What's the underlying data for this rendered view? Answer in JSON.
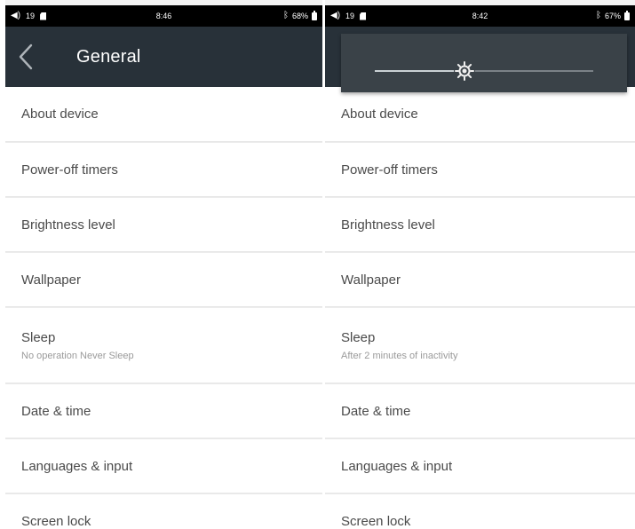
{
  "left": {
    "status": {
      "volume": "19",
      "time": "8:46",
      "battery": "68%"
    },
    "header": {
      "title": "General"
    },
    "items": [
      {
        "label": "About device"
      },
      {
        "label": "Power-off timers"
      },
      {
        "label": "Brightness level"
      },
      {
        "label": "Wallpaper"
      },
      {
        "label": "Sleep",
        "sub": "No operation Never Sleep"
      },
      {
        "label": "Date & time"
      },
      {
        "label": "Languages & input"
      },
      {
        "label": "Screen lock"
      }
    ]
  },
  "right": {
    "status": {
      "volume": "19",
      "time": "8:42",
      "battery": "67%"
    },
    "brightness": {
      "level": 0.41
    },
    "items": [
      {
        "label": "About device"
      },
      {
        "label": "Power-off timers"
      },
      {
        "label": "Brightness level"
      },
      {
        "label": "Wallpaper"
      },
      {
        "label": "Sleep",
        "sub": "After 2 minutes of inactivity"
      },
      {
        "label": "Date & time"
      },
      {
        "label": "Languages & input"
      },
      {
        "label": "Screen lock"
      }
    ]
  },
  "colors": {
    "app_bar": "#283139",
    "status_bar": "#000000",
    "brightness_panel": "#3a4248",
    "list_bg": "#f4f4f4",
    "row_bg": "#ffffff"
  }
}
